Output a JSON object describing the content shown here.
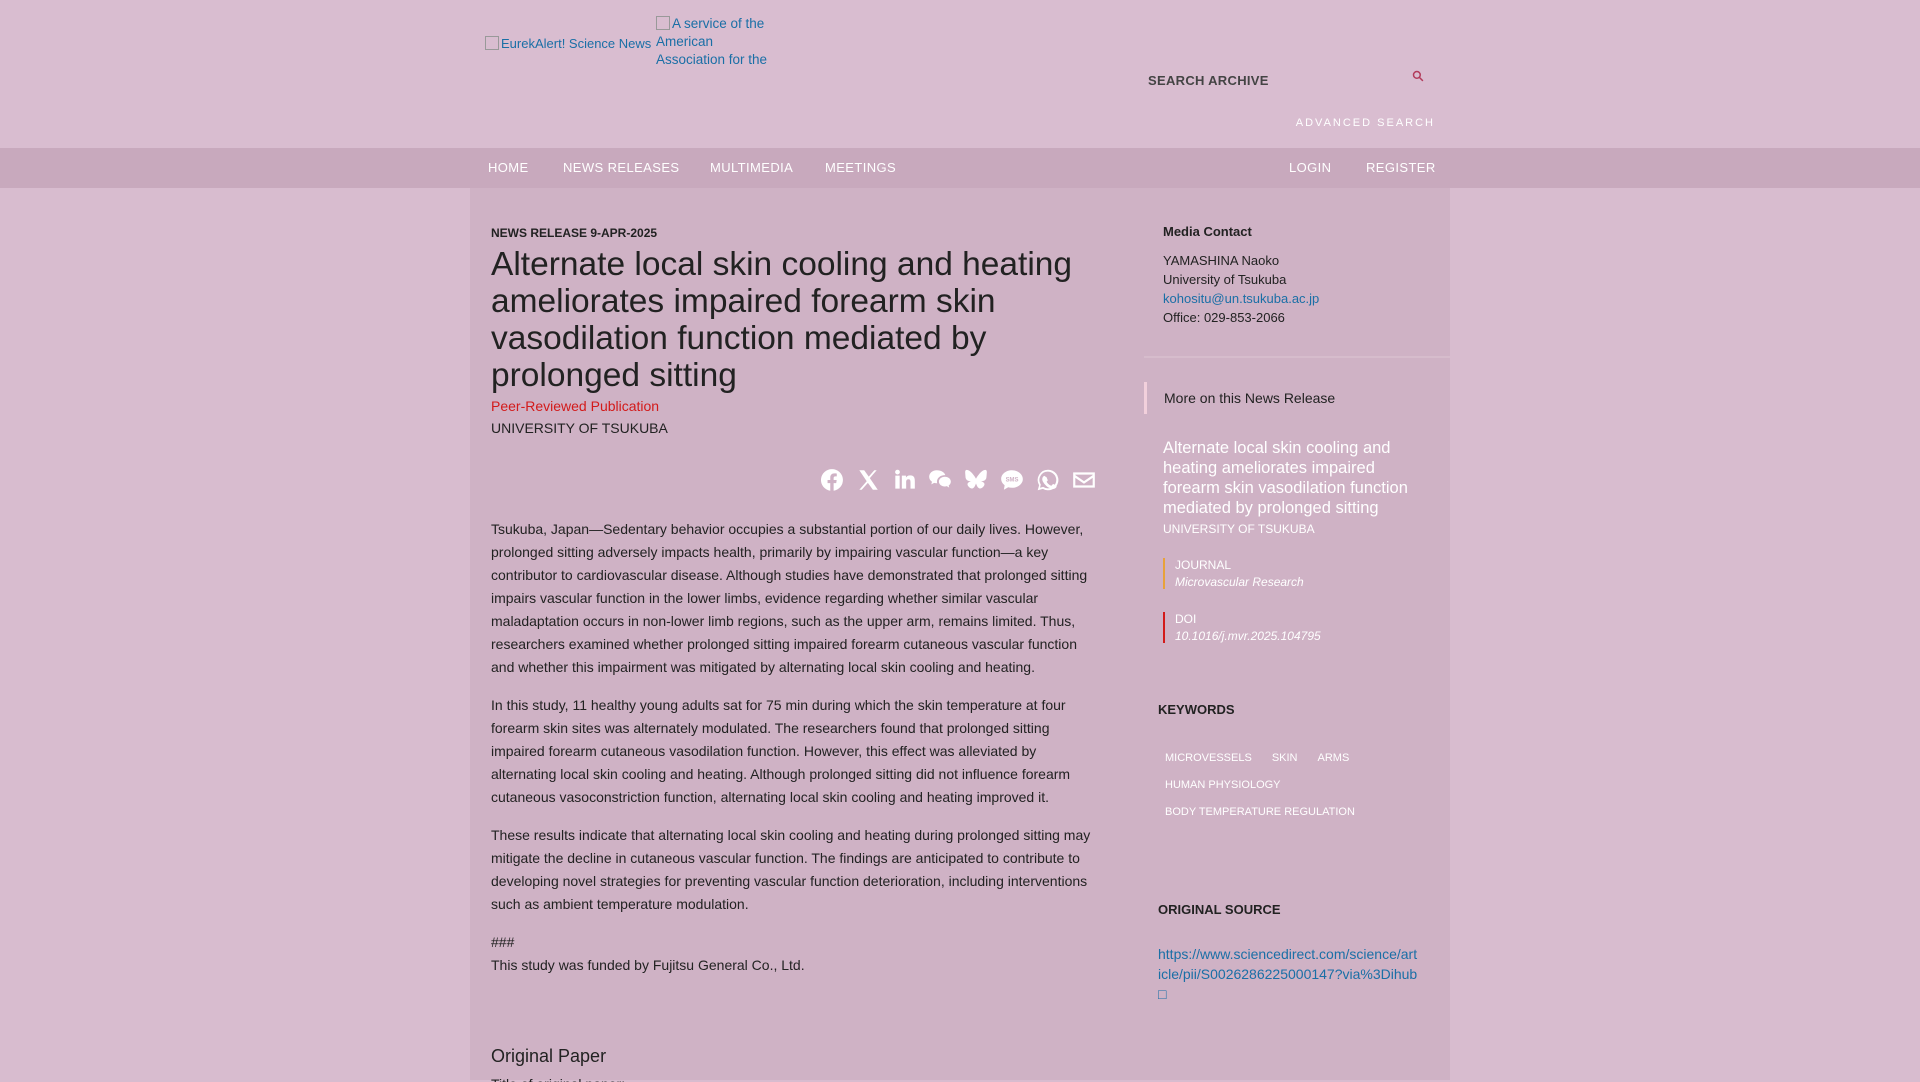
{
  "header": {
    "logo_alt": "EurekAlert! Science News",
    "aaas_alt": "A service of the American Association for the",
    "search_placeholder": "SEARCH ARCHIVE",
    "advanced_search": "ADVANCED SEARCH"
  },
  "nav": {
    "home": "HOME",
    "news_releases": "NEWS RELEASES",
    "multimedia": "MULTIMEDIA",
    "meetings": "MEETINGS",
    "login": "LOGIN",
    "register": "REGISTER"
  },
  "article": {
    "release_date": "NEWS RELEASE 9-APR-2025",
    "title": "Alternate local skin cooling and heating ameliorates impaired forearm skin vasodilation function mediated by prolonged sitting",
    "peer_reviewed": "Peer-Reviewed Publication",
    "institution": "UNIVERSITY OF TSUKUBA",
    "share_buttons": [
      "Facebook",
      "X",
      "LinkedIn",
      "WeChat",
      "Bluesky",
      "SMS",
      "WhatsApp",
      "Email"
    ],
    "paragraphs": [
      "Tsukuba, Japan—Sedentary behavior occupies a substantial portion of our daily lives. However, prolonged sitting adversely impacts health, primarily by impairing vascular function—a key contributor to cardiovascular disease. Although studies have demonstrated that prolonged sitting impairs vascular function in the lower limbs, evidence regarding whether similar vascular maladaptation occurs in non-lower limb regions, such as the upper arm, remains limited. Thus, researchers examined whether prolonged sitting impaired forearm cutaneous vascular function and whether this impairment was mitigated by alternating local skin cooling and heating.",
      "In this study, 11 healthy young adults sat for 75 min during which the skin temperature at four forearm skin sites was alternately modulated. The researchers found that prolonged sitting impaired forearm cutaneous vasodilation function. However, this effect was alleviated by alternating local skin cooling and heating. Although prolonged sitting did not influence forearm cutaneous vasoconstriction function, alternating local skin cooling and heating improved it.",
      "These results indicate that alternating local skin cooling and heating during prolonged sitting may mitigate the decline in cutaneous vascular function. The findings are anticipated to contribute to developing novel strategies for preventing vascular function deterioration, including interventions such as ambient temperature modulation."
    ],
    "hash_line": "###",
    "funding_line": "This study was funded by Fujitsu General Co., Ltd.",
    "original_paper_heading": "Original Paper",
    "original_paper_sub": "Title of original paper:"
  },
  "sidebar": {
    "media_contact_title": "Media Contact",
    "contact_name": "YAMASHINA Naoko",
    "contact_org": "University of Tsukuba",
    "contact_email": "kohositu@un.tsukuba.ac.jp",
    "contact_office": "Office: 029-853-2066",
    "more_on": "More on this News Release",
    "related_title": "Alternate local skin cooling and heating ameliorates impaired forearm skin vasodilation function mediated by prolonged sitting",
    "related_inst": "UNIVERSITY OF TSUKUBA",
    "journal_label": "JOURNAL",
    "journal_value": "Microvascular Research",
    "doi_label": "DOI",
    "doi_value": "10.1016/j.mvr.2025.104795",
    "keywords_heading": "KEYWORDS",
    "keywords_row1": [
      "MICROVESSELS",
      "SKIN",
      "ARMS"
    ],
    "keywords_row2": [
      "HUMAN PHYSIOLOGY"
    ],
    "keywords_row3": [
      "BODY TEMPERATURE REGULATION"
    ],
    "original_source_heading": "ORIGINAL SOURCE",
    "original_source_link": "https://www.sciencedirect.com/science/article/pii/S0026286225000147?via%3Dihub □"
  },
  "colors": {
    "page_bg": "#d8bccf",
    "nav_bg": "#c8a9bd",
    "panel_bg": "#cfb2c5",
    "link": "#1a6fa6",
    "peer_red": "#d31a1a",
    "journal_accent": "#e8a23a",
    "doi_accent": "#d31a1a"
  }
}
